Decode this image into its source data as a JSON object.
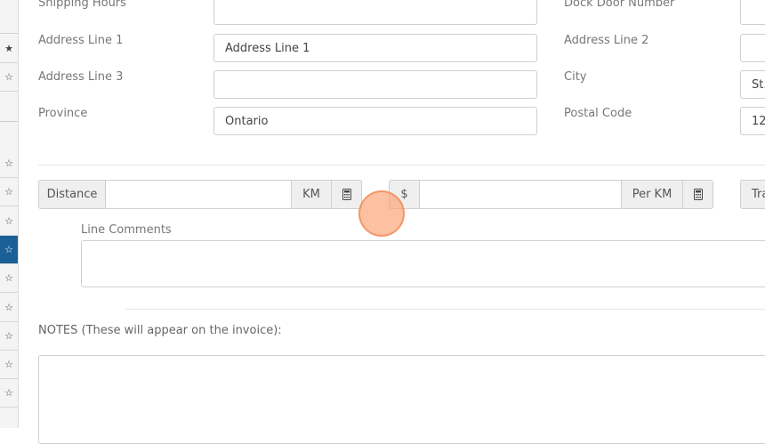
{
  "sidebar": {
    "icons": [
      {
        "icon": "star-filled-icon",
        "glyph": "★",
        "active": false
      },
      {
        "icon": "star-outline-icon",
        "glyph": "☆",
        "active": false
      },
      {
        "icon": "star-outline-icon",
        "glyph": "☆",
        "active": false
      },
      {
        "icon": "star-outline-icon",
        "glyph": "☆",
        "active": false
      },
      {
        "icon": "star-outline-icon",
        "glyph": "☆",
        "active": false
      },
      {
        "icon": "star-outline-icon",
        "glyph": "☆",
        "active": true
      },
      {
        "icon": "star-outline-icon",
        "glyph": "☆",
        "active": false
      },
      {
        "icon": "star-outline-icon",
        "glyph": "☆",
        "active": false
      },
      {
        "icon": "star-outline-icon",
        "glyph": "☆",
        "active": false
      },
      {
        "icon": "star-outline-icon",
        "glyph": "☆",
        "active": false
      },
      {
        "icon": "star-outline-icon",
        "glyph": "☆",
        "active": false
      }
    ],
    "active_color": "#1b5f97"
  },
  "address_form": {
    "shipping_hours": {
      "label": "Shipping Hours",
      "value": ""
    },
    "dock_door_number": {
      "label": "Dock Door Number",
      "value": ""
    },
    "address_line_1": {
      "label": "Address Line 1",
      "value": "Address Line 1"
    },
    "address_line_2": {
      "label": "Address Line 2",
      "value": ""
    },
    "address_line_3": {
      "label": "Address Line 3",
      "value": ""
    },
    "city": {
      "label": "City",
      "value": "St."
    },
    "province": {
      "label": "Province",
      "value": "Ontario"
    },
    "postal_code": {
      "label": "Postal Code",
      "value": "12"
    }
  },
  "charges": {
    "distance_label": "Distance",
    "distance_value": "",
    "km_unit": "KM",
    "currency_symbol": "$",
    "rate_value": "",
    "per_km_unit": "Per KM",
    "calculator_icon": "calculator-icon",
    "next_addon_partial": "Tra"
  },
  "line_comments": {
    "label": "Line Comments",
    "value": ""
  },
  "notes": {
    "label": "NOTES (These will appear on the invoice):",
    "value": ""
  }
}
